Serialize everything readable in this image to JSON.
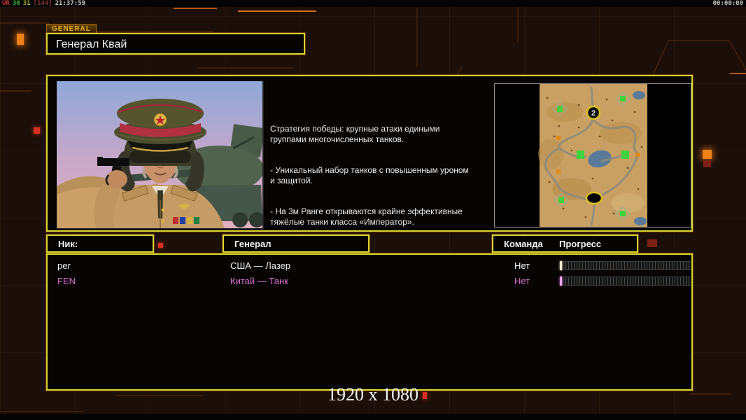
{
  "colors": {
    "accent_yellow": "#d6d62e",
    "accent_orange": "#c96a1a",
    "player_white": "#f2f2f2",
    "player_pink": "#d66fd6",
    "tab_text": "#e9b41f",
    "background": "#1c0f09"
  },
  "osd": {
    "left": [
      {
        "text": "UR",
        "color": "#c83232"
      },
      {
        "text": "30",
        "color": "#39b339"
      },
      {
        "text": "31",
        "color": "#a8a832"
      },
      {
        "text": "[144]",
        "color": "#8a3030"
      },
      {
        "text": "21:37:59",
        "color": "#c9c2bc"
      }
    ],
    "right_time": "00:00:00"
  },
  "tab": {
    "label": "GENERAL"
  },
  "general_panel": {
    "title": "Генерал Квай",
    "description_paragraphs": [
      "Стратегия победы: крупные атаки едиными\nгруппами многочисленных танков.",
      "- Уникальный набор танков с повышенным уроном\nи защитой.",
      "- На 3м Ранге открываются крайне эффективные\nтяжёлые танки класса «Император»."
    ]
  },
  "minimap": {
    "marker_top_label": "2"
  },
  "table": {
    "headers": {
      "nick": "Ник:",
      "general": "Генерал",
      "team": "Команда",
      "progress": "Прогресс"
    },
    "players": [
      {
        "nick": "per",
        "general": "США — Лазер",
        "team": "Нет",
        "progress_percent": 0,
        "color": "#f2f2f2"
      },
      {
        "nick": "FEN",
        "general": "Китай — Танк",
        "team": "Нет",
        "progress_percent": 0,
        "color": "#d66fd6"
      }
    ]
  },
  "footer": {
    "resolution": "1920 x 1080"
  }
}
